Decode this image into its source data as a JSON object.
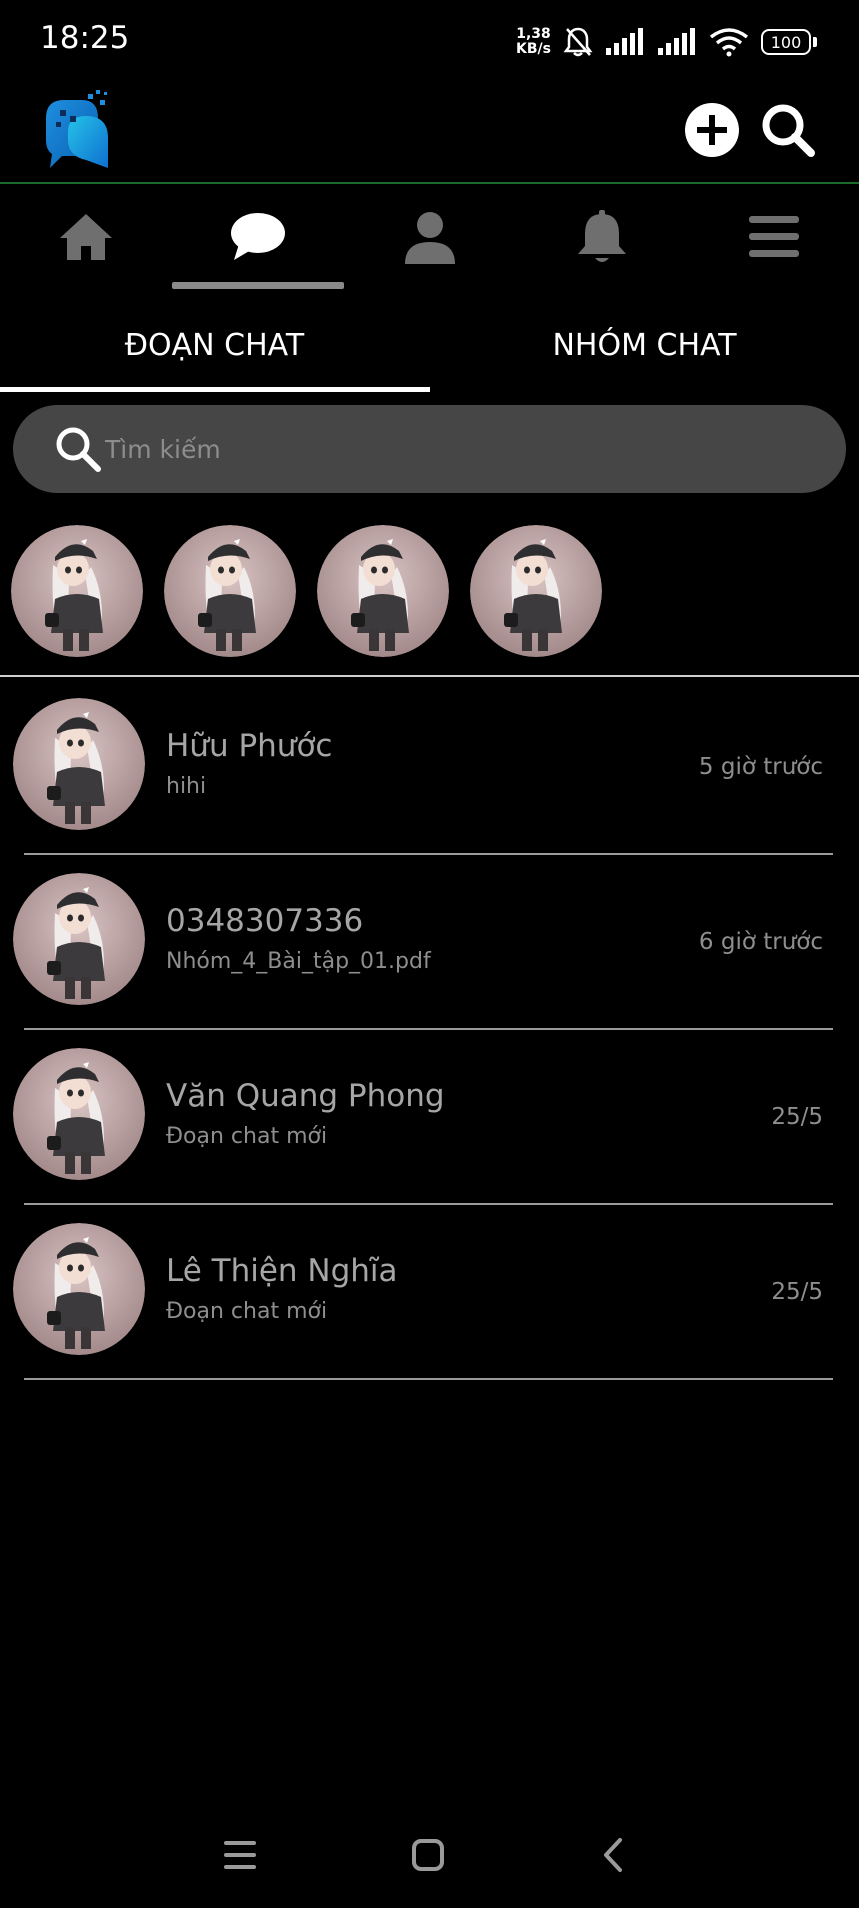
{
  "status_bar": {
    "time": "18:25",
    "net_speed_value": "1,38",
    "net_speed_unit": "KB/s",
    "battery": "100"
  },
  "header": {
    "logo_icon": "app-logo-icon",
    "add_icon": "plus-circle-icon",
    "search_icon": "search-icon"
  },
  "nav": {
    "items": [
      {
        "icon": "home-icon",
        "active": false
      },
      {
        "icon": "chat-bubble-icon",
        "active": true
      },
      {
        "icon": "user-icon",
        "active": false
      },
      {
        "icon": "bell-icon",
        "active": false
      },
      {
        "icon": "menu-icon",
        "active": false
      }
    ]
  },
  "tabs": [
    {
      "label": "ĐOẠN CHAT",
      "active": true
    },
    {
      "label": "NHÓM CHAT",
      "active": false
    }
  ],
  "search": {
    "placeholder": "Tìm kiếm"
  },
  "stories_count": 4,
  "conversations": [
    {
      "name": "Hữu Phước",
      "preview": "hihi",
      "time": "5 giờ trước"
    },
    {
      "name": "0348307336",
      "preview": "Nhóm_4_Bài_tập_01.pdf",
      "time": "6 giờ trước"
    },
    {
      "name": "Văn Quang Phong",
      "preview": "Đoạn chat mới",
      "time": "25/5"
    },
    {
      "name": "Lê Thiện Nghĩa",
      "preview": "Đoạn chat mới",
      "time": "25/5"
    }
  ],
  "colors": {
    "background": "#000000",
    "accent_line": "#1b6b2a",
    "search_bg": "#464646",
    "icon_gray": "#6f6f6f"
  }
}
